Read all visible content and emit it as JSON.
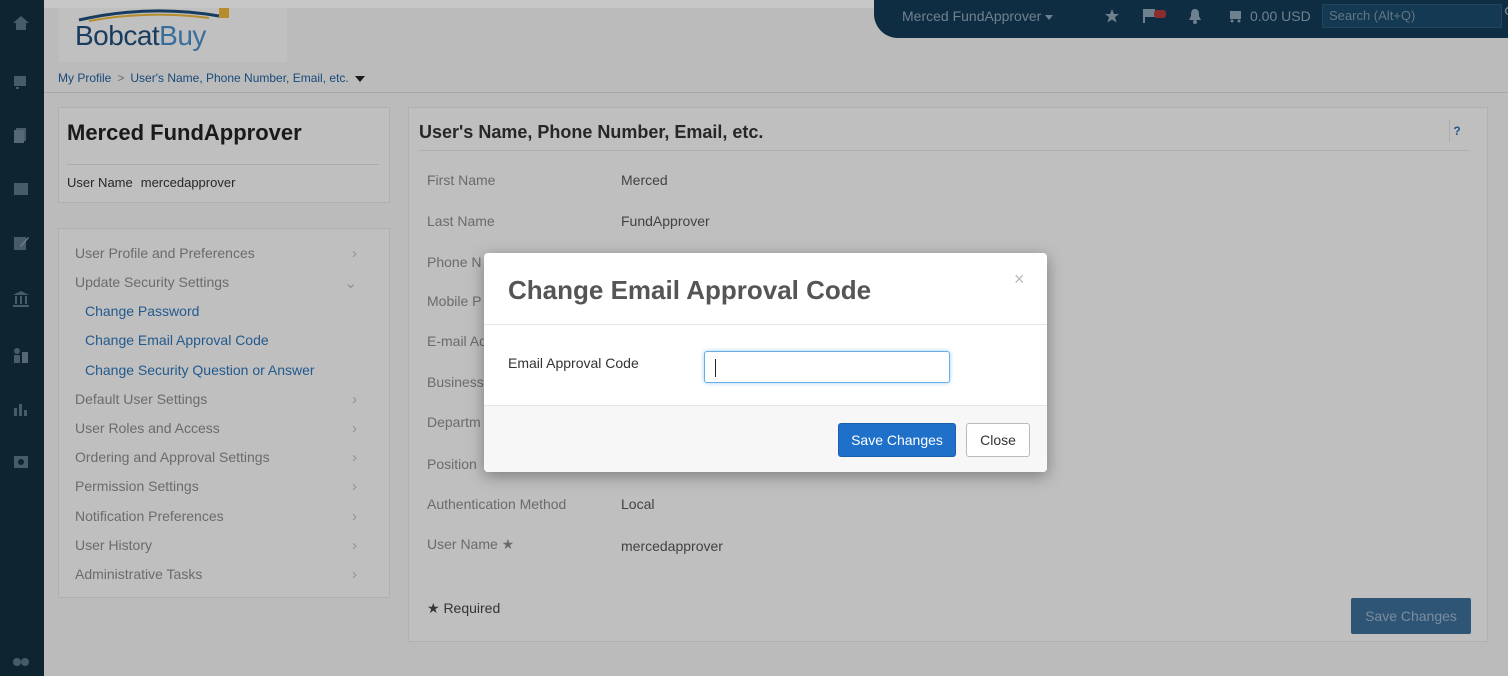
{
  "app": {
    "logo_part1": "Bobcat",
    "logo_part2": "Buy"
  },
  "header": {
    "user_menu_label": "Merced FundApprover",
    "cart_total": "0.00 USD",
    "search_placeholder": "Search (Alt+Q)"
  },
  "breadcrumb": {
    "root": "My Profile",
    "current": "User's Name, Phone Number, Email, etc."
  },
  "profile": {
    "name": "Merced FundApprover",
    "user_name_label": "User Name",
    "user_name_value": "mercedapprover"
  },
  "menu": {
    "items": [
      {
        "label": "User Profile and Preferences",
        "chevron": "›"
      },
      {
        "label": "Update Security Settings",
        "chevron": "⌄"
      },
      {
        "label": "Default User Settings",
        "chevron": "›"
      },
      {
        "label": "User Roles and Access",
        "chevron": "›"
      },
      {
        "label": "Ordering and Approval Settings",
        "chevron": "›"
      },
      {
        "label": "Permission Settings",
        "chevron": "›"
      },
      {
        "label": "Notification Preferences",
        "chevron": "›"
      },
      {
        "label": "User History",
        "chevron": "›"
      },
      {
        "label": "Administrative Tasks",
        "chevron": "›"
      }
    ],
    "sub_items": [
      {
        "label": "Change Password"
      },
      {
        "label": "Change Email Approval Code"
      },
      {
        "label": "Change Security Question or Answer"
      }
    ]
  },
  "main": {
    "title": "User's Name, Phone Number, Email, etc.",
    "help_label": "?",
    "fields": [
      {
        "label": "First Name",
        "value": "Merced"
      },
      {
        "label": "Last Name",
        "value": "FundApprover"
      },
      {
        "label": "Phone N",
        "value": ""
      },
      {
        "label": "Mobile P",
        "value": ""
      },
      {
        "label": "E-mail Ad",
        "value": ""
      },
      {
        "label": "Business",
        "value": ""
      },
      {
        "label": "Departm",
        "value": ""
      },
      {
        "label": "Position",
        "value": ""
      },
      {
        "label": "Authentication Method",
        "value": "Local"
      },
      {
        "label": "User Name ★",
        "value": "mercedapprover"
      }
    ],
    "required_note": "★ Required",
    "save_label": "Save Changes"
  },
  "modal": {
    "title": "Change Email Approval Code",
    "close_glyph": "×",
    "field_label": "Email Approval Code",
    "field_value": "",
    "save_label": "Save Changes",
    "close_label": "Close"
  },
  "colors": {
    "rail": "#13303f",
    "userbar": "#133a55",
    "primary": "#1f70c9",
    "link": "#2e74b5"
  }
}
